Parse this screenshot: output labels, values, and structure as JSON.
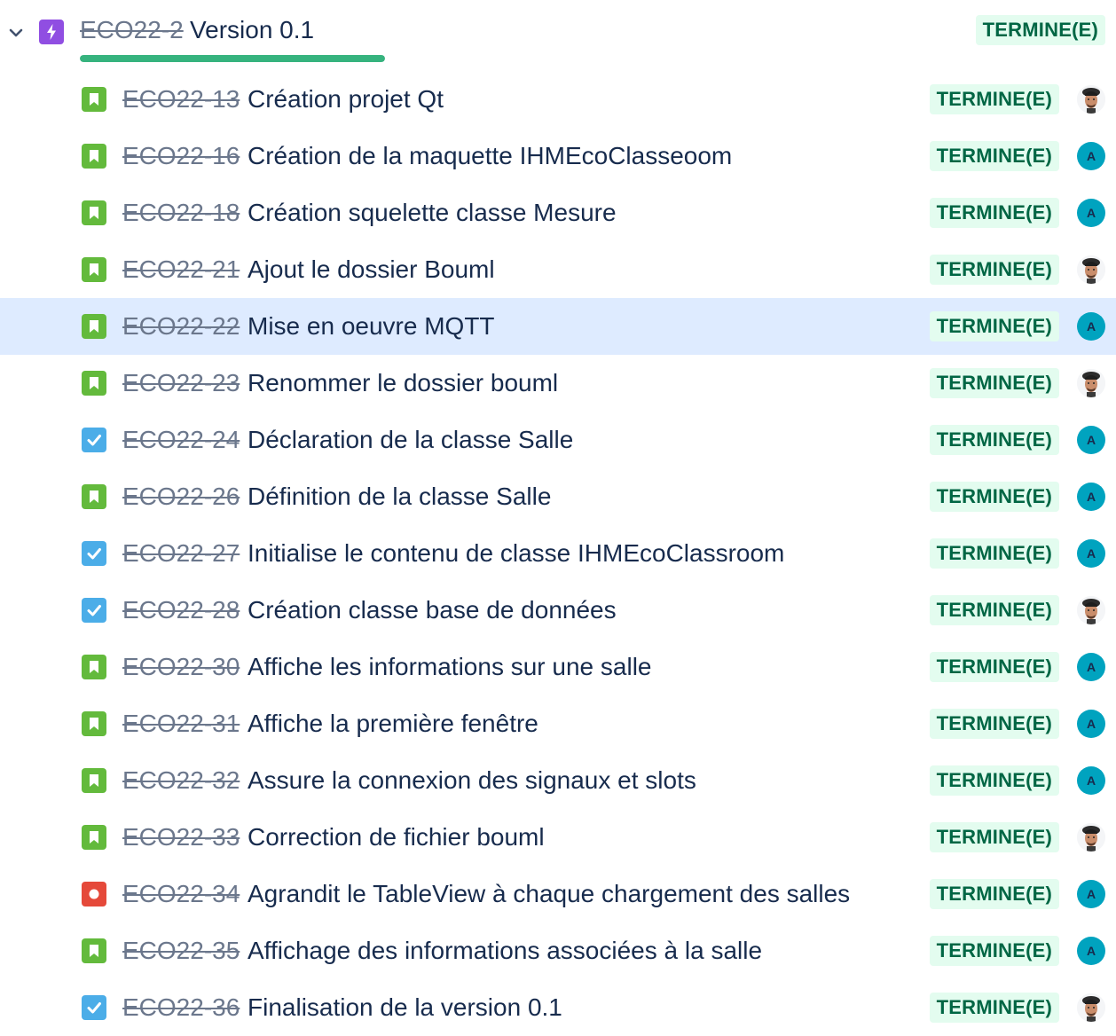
{
  "epic": {
    "key": "ECO22-2",
    "title": "Version 0.1",
    "status": "TERMINE(E)",
    "icon": "lightning-icon",
    "progress_done_fraction": 1.0,
    "colors": {
      "epic_purple": "#904ee2",
      "progress_green": "#36b37e"
    }
  },
  "status_colors": {
    "done_bg": "#e3fcef",
    "done_text": "#006644"
  },
  "issues": [
    {
      "key": "ECO22-13",
      "title": "Création projet Qt",
      "type": "story",
      "status": "TERMINE(E)",
      "assignee": {
        "kind": "photo"
      }
    },
    {
      "key": "ECO22-16",
      "title": "Création de la maquette IHMEcoClasseoom",
      "type": "story",
      "status": "TERMINE(E)",
      "assignee": {
        "kind": "initial",
        "initial": "A"
      }
    },
    {
      "key": "ECO22-18",
      "title": "Création squelette classe Mesure",
      "type": "story",
      "status": "TERMINE(E)",
      "assignee": {
        "kind": "initial",
        "initial": "A"
      }
    },
    {
      "key": "ECO22-21",
      "title": "Ajout le dossier Bouml",
      "type": "story",
      "status": "TERMINE(E)",
      "assignee": {
        "kind": "photo"
      }
    },
    {
      "key": "ECO22-22",
      "title": "Mise en oeuvre MQTT",
      "type": "story",
      "status": "TERMINE(E)",
      "assignee": {
        "kind": "initial",
        "initial": "A"
      },
      "selected": true
    },
    {
      "key": "ECO22-23",
      "title": "Renommer le dossier bouml",
      "type": "story",
      "status": "TERMINE(E)",
      "assignee": {
        "kind": "photo"
      }
    },
    {
      "key": "ECO22-24",
      "title": "Déclaration de la classe Salle",
      "type": "task",
      "status": "TERMINE(E)",
      "assignee": {
        "kind": "initial",
        "initial": "A"
      }
    },
    {
      "key": "ECO22-26",
      "title": "Définition de la classe Salle",
      "type": "story",
      "status": "TERMINE(E)",
      "assignee": {
        "kind": "initial",
        "initial": "A"
      }
    },
    {
      "key": "ECO22-27",
      "title": "Initialise le contenu de classe IHMEcoClassroom",
      "type": "task",
      "status": "TERMINE(E)",
      "assignee": {
        "kind": "initial",
        "initial": "A"
      }
    },
    {
      "key": "ECO22-28",
      "title": "Création classe base de données",
      "type": "task",
      "status": "TERMINE(E)",
      "assignee": {
        "kind": "photo"
      }
    },
    {
      "key": "ECO22-30",
      "title": "Affiche les informations sur une salle",
      "type": "story",
      "status": "TERMINE(E)",
      "assignee": {
        "kind": "initial",
        "initial": "A"
      }
    },
    {
      "key": "ECO22-31",
      "title": "Affiche la première fenêtre",
      "type": "story",
      "status": "TERMINE(E)",
      "assignee": {
        "kind": "initial",
        "initial": "A"
      }
    },
    {
      "key": "ECO22-32",
      "title": "Assure la connexion des signaux et slots",
      "type": "story",
      "status": "TERMINE(E)",
      "assignee": {
        "kind": "initial",
        "initial": "A"
      }
    },
    {
      "key": "ECO22-33",
      "title": "Correction de fichier bouml",
      "type": "story",
      "status": "TERMINE(E)",
      "assignee": {
        "kind": "photo"
      }
    },
    {
      "key": "ECO22-34",
      "title": "Agrandit le TableView à chaque chargement des salles",
      "type": "bug",
      "status": "TERMINE(E)",
      "assignee": {
        "kind": "initial",
        "initial": "A"
      }
    },
    {
      "key": "ECO22-35",
      "title": "Affichage des informations associées à la salle",
      "type": "story",
      "status": "TERMINE(E)",
      "assignee": {
        "kind": "initial",
        "initial": "A"
      }
    },
    {
      "key": "ECO22-36",
      "title": "Finalisation de la version 0.1",
      "type": "task",
      "status": "TERMINE(E)",
      "assignee": {
        "kind": "photo"
      }
    }
  ],
  "type_icons": {
    "story": {
      "icon": "bookmark-icon",
      "color": "#63ba3c"
    },
    "task": {
      "icon": "checkmark-icon",
      "color": "#4bade8"
    },
    "bug": {
      "icon": "bug-dot-icon",
      "color": "#e5493a"
    }
  },
  "avatar_colors": {
    "initial_bg": "#00a3bf"
  }
}
